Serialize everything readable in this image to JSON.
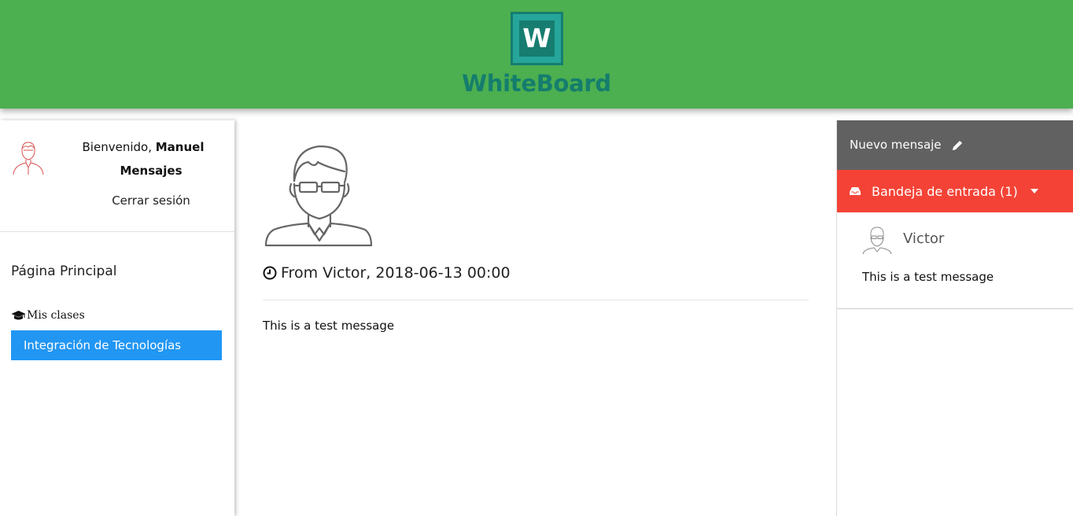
{
  "header": {
    "logo_letter": "W",
    "brand": "WhiteBoard",
    "bg_color": "#4caf50"
  },
  "sidebar": {
    "avatar_icon": "user-avatar-icon",
    "welcome_prefix": "Bienvenido,",
    "user_name": "Manuel",
    "messages_link": "Mensajes",
    "logout_link": "Cerrar sesión",
    "home_link": "Página Principal",
    "classes_heading": "Mis clases",
    "classes_icon": "graduation-cap-icon",
    "classes": [
      {
        "label": "Integración de Tecnologías",
        "active": true
      }
    ]
  },
  "message": {
    "header_text": "From Victor, 2018-06-13 00:00",
    "body": "This is a test message"
  },
  "inbox_panel": {
    "new_message_label": "Nuevo mensaje",
    "inbox_label": "Bandeja de entrada (1)",
    "new_message_color": "#616161",
    "inbox_color": "#f44336",
    "items": [
      {
        "sender": "Victor",
        "preview": "This is a test message"
      }
    ]
  }
}
